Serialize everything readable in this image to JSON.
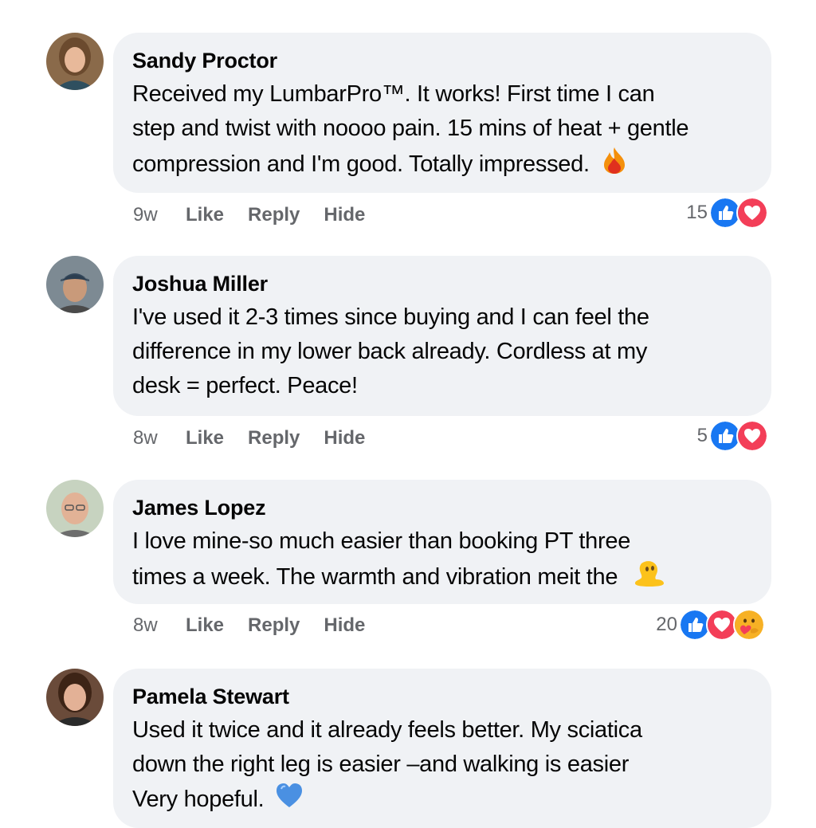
{
  "comments": [
    {
      "author": "Sandy Proctor",
      "lines": [
        "Received my LumbarPro™. It works! First time I can",
        "step and twist with noooo pain. 15 mins of heat + gentle",
        "compression and I'm good. Totally impressed."
      ],
      "emoji": "fire-emoji",
      "time": "9w",
      "like": "Like",
      "reply": "Reply",
      "hide": "Hide",
      "reaction_count": "15",
      "reactions": [
        "like-reaction-icon",
        "love-reaction-icon"
      ]
    },
    {
      "author": "Joshua Miller",
      "lines": [
        "I've used it 2-3 times since buying and I can feel the",
        "difference in my lower back already. Cordless at my",
        "desk = perfect. Peace!"
      ],
      "time": "8w",
      "like": "Like",
      "reply": "Reply",
      "hide": "Hide",
      "reaction_count": "5",
      "reactions": [
        "like-reaction-icon",
        "love-reaction-icon"
      ]
    },
    {
      "author": "James Lopez",
      "lines": [
        "I love mine-so much easier than booking PT three",
        "times a week. The warmth and vibration meit the"
      ],
      "emoji": "melting-emoji",
      "time": "8w",
      "like": "Like",
      "reply": "Reply",
      "hide": "Hide",
      "reaction_count": "20",
      "reactions": [
        "like-reaction-icon",
        "love-reaction-icon",
        "care-reaction-icon"
      ]
    },
    {
      "author": "Pamela Stewart",
      "lines": [
        "Used it twice and it already feels better. My sciatica",
        "down the right leg is easier –and walking is easier",
        "Very hopeful."
      ],
      "emoji": "blue-heart-emoji"
    }
  ],
  "colors": {
    "bubble": "#f0f2f5",
    "meta_text": "#65676b",
    "like_blue": "#1877f2",
    "love_red": "#f33e58"
  }
}
